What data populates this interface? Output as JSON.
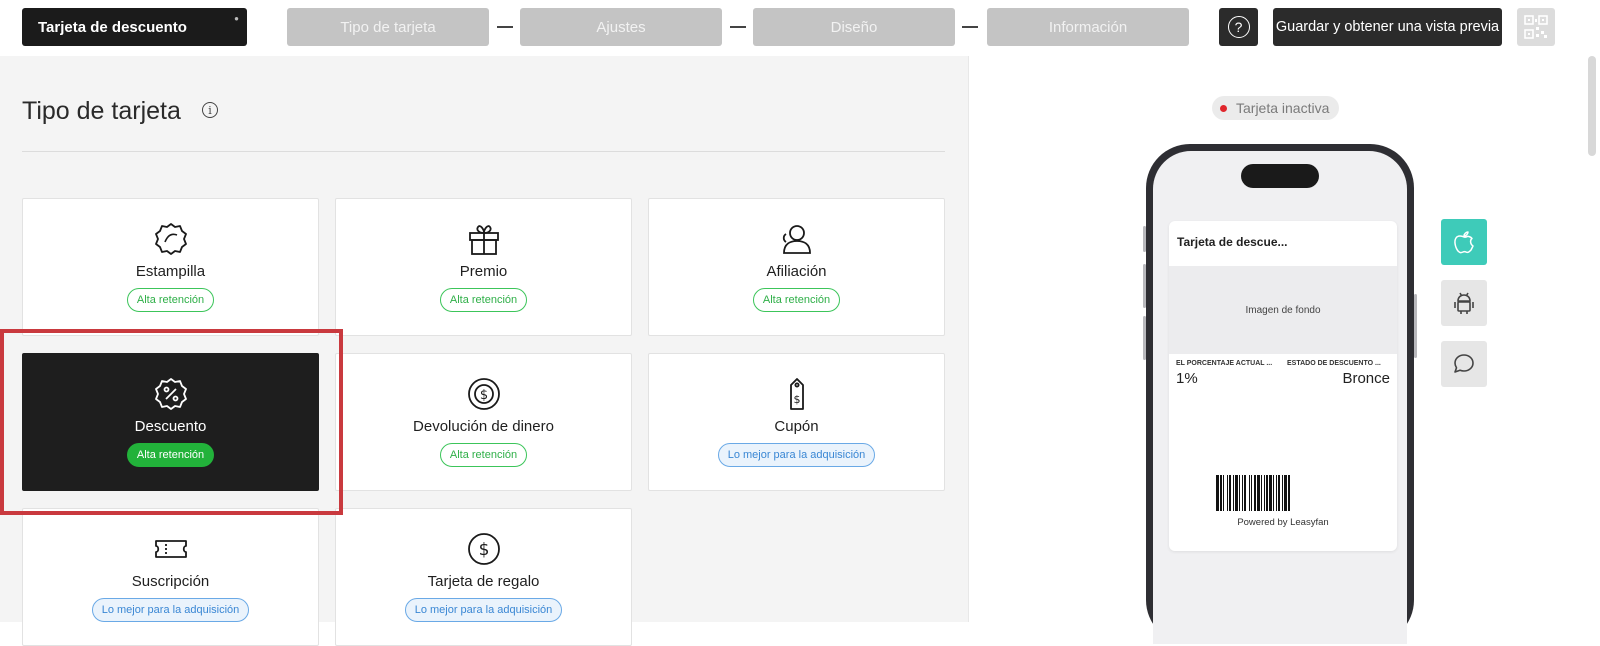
{
  "header": {
    "card_name": "Tarjeta de descuento",
    "steps": [
      "Tipo de tarjeta",
      "Ajustes",
      "Diseño",
      "Información"
    ],
    "help_label": "?",
    "save_label": "Guardar y obtener una vista previa"
  },
  "section": {
    "title": "Tipo de tarjeta",
    "info_label": "i"
  },
  "card_types": [
    {
      "name": "Estampilla",
      "badge": "Alta retención",
      "badge_color": "#3cc55a",
      "icon": "stamp-icon"
    },
    {
      "name": "Premio",
      "badge": "Alta retención",
      "badge_color": "#3cc55a",
      "icon": "gift-icon"
    },
    {
      "name": "Afiliación",
      "badge": "Alta retención",
      "badge_color": "#3cc55a",
      "icon": "membership-icon"
    },
    {
      "name": "Descuento",
      "badge": "Alta retención",
      "badge_color": "#22b23a",
      "icon": "discount-icon",
      "selected": true
    },
    {
      "name": "Devolución de dinero",
      "badge": "Alta retención",
      "badge_color": "#3cc55a",
      "icon": "cashback-icon"
    },
    {
      "name": "Cupón",
      "badge": "Lo mejor para la adquisición",
      "badge_color": "#6aa9e6",
      "icon": "coupon-icon"
    },
    {
      "name": "Suscripción",
      "badge": "Lo mejor para la adquisición",
      "badge_color": "#6aa9e6",
      "icon": "ticket-icon"
    },
    {
      "name": "Tarjeta de regalo",
      "badge": "Lo mejor para la adquisición",
      "badge_color": "#6aa9e6",
      "icon": "dollar-icon"
    }
  ],
  "preview": {
    "status": "Tarjeta inactiva",
    "status_color": "#e0262c",
    "pass_title": "Tarjeta de descue...",
    "background_label": "Imagen de fondo",
    "field1_label": "EL PORCENTAJE ACTUAL ...",
    "field1_value": "1%",
    "field2_label": "ESTADO DE DESCUENTO ...",
    "field2_value": "Bronce",
    "powered_by": "Powered by Leasyfan",
    "platforms": [
      "apple-icon",
      "android-icon",
      "chat-icon"
    ],
    "active_platform_color": "#3ecbb9"
  }
}
